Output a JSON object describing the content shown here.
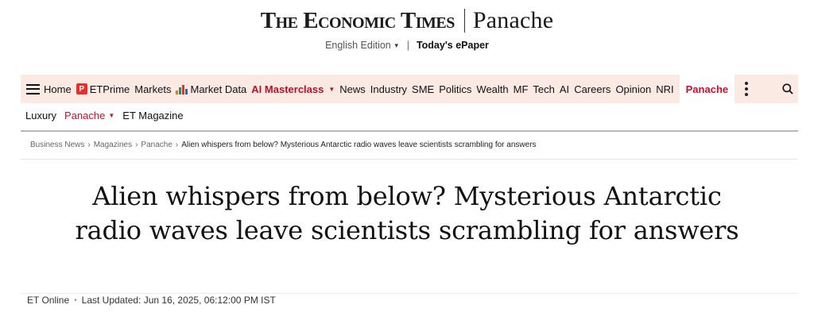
{
  "masthead": {
    "logo_main": "The Economic Times",
    "logo_section": "Panache"
  },
  "edition_bar": {
    "edition_label": "English Edition",
    "separator": "|",
    "epaper_label": "Today's ePaper"
  },
  "nav": {
    "items": [
      "Home",
      "ETPrime",
      "Markets",
      "Market Data",
      "AI Masterclass",
      "News",
      "Industry",
      "SME",
      "Politics",
      "Wealth",
      "MF",
      "Tech",
      "AI",
      "Careers",
      "Opinion",
      "NRI",
      "Panache"
    ],
    "icons": {
      "menu": "hamburger-menu-icon",
      "etprime": "etprime-logo-icon",
      "market_data": "bar-chart-icon",
      "more": "vertical-dots-icon",
      "search": "search-icon"
    },
    "active_color": "#c8102e",
    "background_color": "#fbe9e3"
  },
  "subnav": {
    "items": [
      "Luxury",
      "Panache",
      "ET Magazine"
    ]
  },
  "breadcrumb": {
    "items": [
      "Business News",
      "Magazines",
      "Panache"
    ],
    "current": "Alien whispers from below? Mysterious Antarctic radio waves leave scientists scrambling for answers"
  },
  "article": {
    "headline": "Alien whispers from below? Mysterious Antarctic radio waves leave scientists scrambling for answers",
    "author": "ET Online",
    "updated": "Last Updated: Jun 16, 2025, 06:12:00 PM IST"
  }
}
